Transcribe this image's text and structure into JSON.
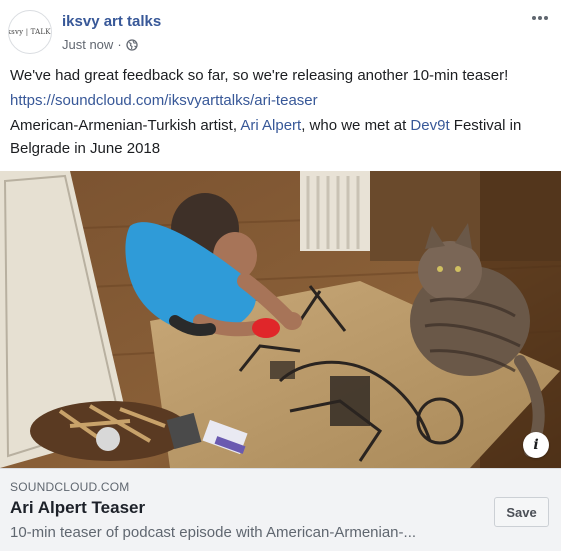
{
  "post": {
    "author": "iksvy art talks",
    "avatar_text": "iksvy | TALKS",
    "timestamp": "Just now",
    "separator": "·",
    "privacy_icon": "globe-icon",
    "more_icon": "more-options-icon"
  },
  "content": {
    "line1": "We've had great feedback so far, so we're releasing another 10-min teaser!",
    "url": "https://soundcloud.com/iksvyarttalks/ari-teaser",
    "line3_prefix": "American-Armenian-Turkish artist, ",
    "line3_mention": "Ari Alpert",
    "line3_middle": ", who we met at ",
    "line3_tag": "Dev9t",
    "line3_suffix": " Festival in Belgrade in June 2018"
  },
  "media": {
    "info_label": "i"
  },
  "link_card": {
    "domain": "SOUNDCLOUD.COM",
    "title": "Ari Alpert Teaser",
    "description": "10-min teaser of podcast episode with American-Armenian-...",
    "save_label": "Save"
  },
  "colors": {
    "link": "#385898",
    "text": "#1c1e21",
    "muted": "#616770",
    "card_bg": "#f2f3f5"
  }
}
